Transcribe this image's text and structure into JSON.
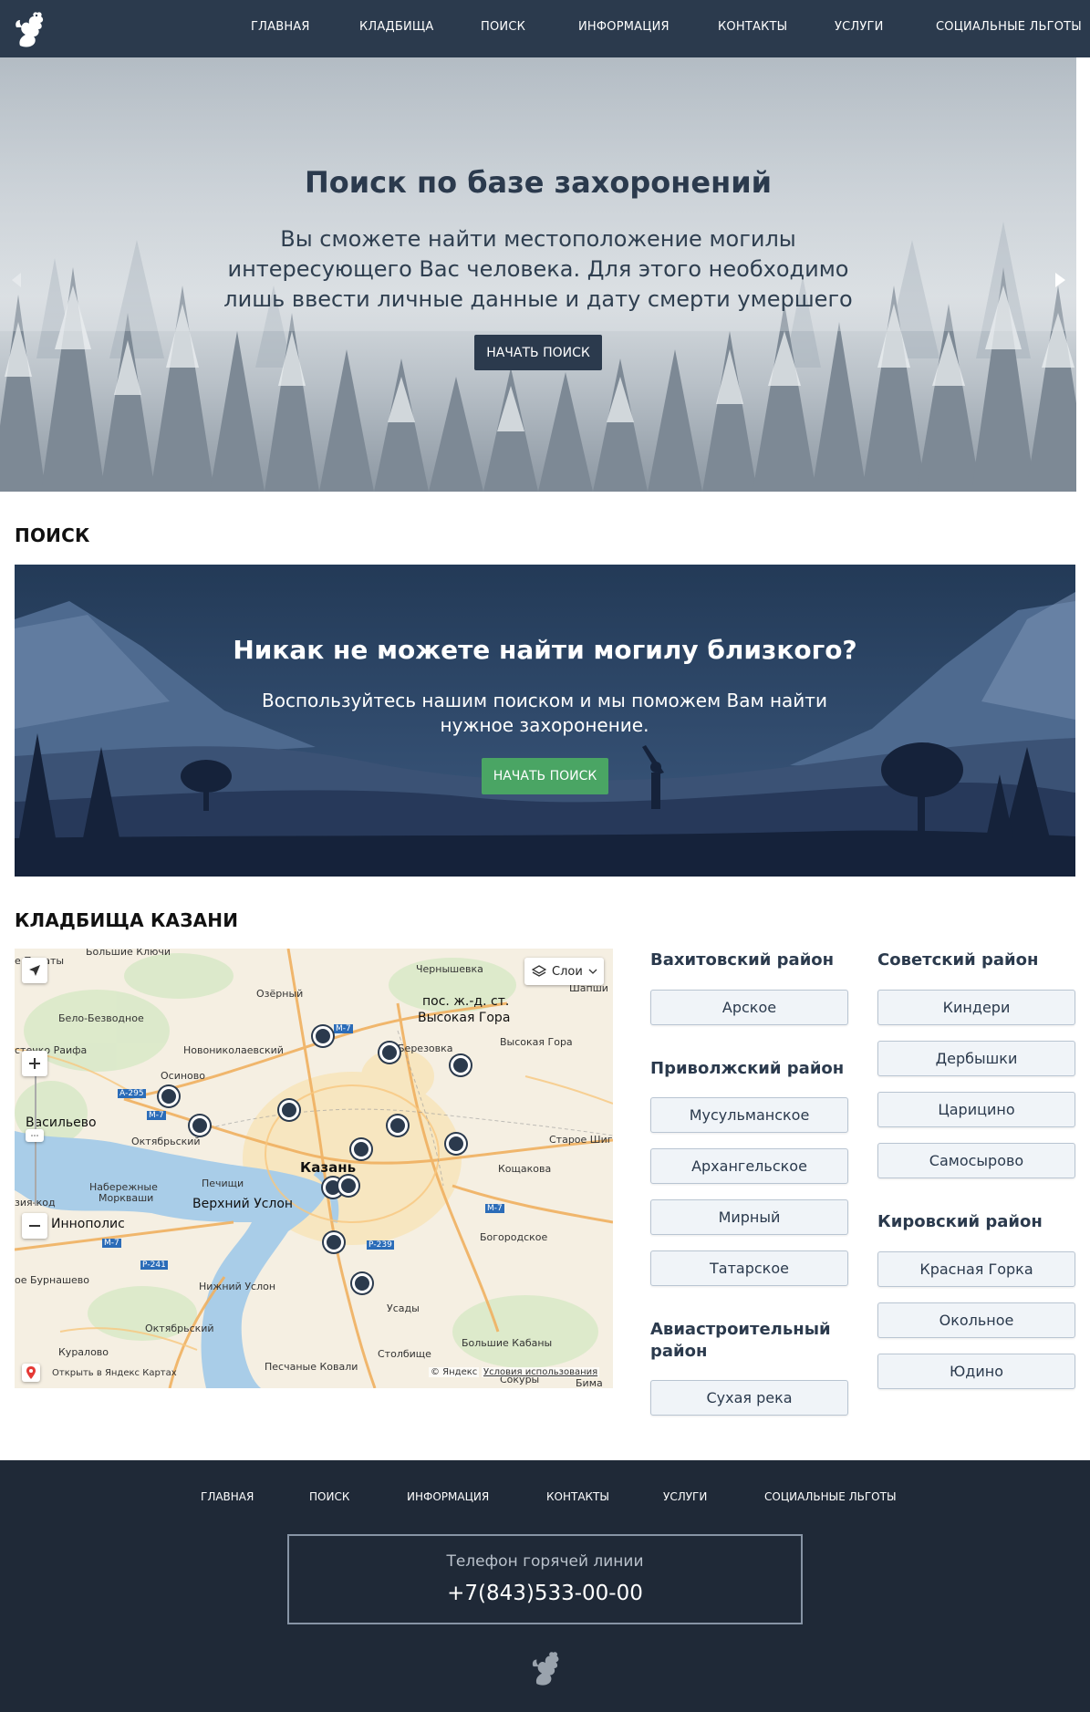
{
  "nav": {
    "items": [
      "ГЛАВНАЯ",
      "КЛАДБИЩА",
      "ПОИСК",
      "ИНФОРМАЦИЯ",
      "КОНТАКТЫ",
      "УСЛУГИ",
      "СОЦИАЛЬНЫЕ ЛЬГОТЫ"
    ]
  },
  "hero": {
    "title": "Поиск по базе захоронений",
    "text": "Вы сможете найти местоположение могилы интересующего Вас человека. Для этого необходимо лишь ввести личные данные и дату смерти умершего",
    "button": "НАЧАТЬ ПОИСК"
  },
  "search_section": {
    "heading": "ПОИСК",
    "banner_title": "Никак не можете найти могилу близкого?",
    "banner_text": "Воспользуйтесь нашим поиском и мы поможем Вам найти нужное захоронение.",
    "button": "НАЧАТЬ ПОИСК"
  },
  "cemeteries_section": {
    "heading": "КЛАДБИЩА КАЗАНИ"
  },
  "map": {
    "layers_label": "Слои",
    "open_in_maps": "Открыть в Яндекс Картах",
    "copyright": "© Яндекс",
    "terms": "Условия использования",
    "labels": {
      "bolshie_klyuchi": "Большие Ключи",
      "paraty": "е Параты",
      "chernyshevka": "Чернышевка",
      "shapshi": "Шапши",
      "ozerny": "Озёрный",
      "pos_vysokaya_gora": "пос. ж.-д. ст.",
      "vysokaya_gora_big": "Высокая Гора",
      "belo_bezvodnoe": "Бело-Безводное",
      "novonikolaevsky": "Новониколаевский",
      "berezovka": "Березовка",
      "vysokaya_gora": "Высокая Гора",
      "raifa": "стечко Раифа",
      "osinovo": "Осиново",
      "vasilevo": "Васильево",
      "oktyabrsky1": "Октябрьский",
      "staroe_shigaleevo": "Старое Шига",
      "kazan": "Казань",
      "koshchakovo": "Кощакова",
      "pechishchi": "Печищи",
      "naberezhnye_morkvashi": "Набережные",
      "morkvashi": "Моркваши",
      "verkhny_uslon": "Верхний Услон",
      "vasilevo2": "зия-код",
      "innopolis": "Иннополис",
      "bogorodskoe": "Богородское",
      "burnashevo": "ое Бурнашево",
      "nizhny_uslon": "Нижний Услон",
      "usady": "Усады",
      "oktyabrsky2": "Октябрьский",
      "kuralovo": "Куралово",
      "stolbishche": "Столбище",
      "bolshie_kabany": "Большие Кабаны",
      "peschanye_kovali": "Песчаные Ковали",
      "sokury": "Сокуры",
      "bima": "Бима",
      "m7a": "М-7",
      "a295": "А-295",
      "m7b": "М-7",
      "m7c": "М-7",
      "p241": "Р-241",
      "m7d": "М-7",
      "p239": "Р-239"
    }
  },
  "districts": [
    {
      "name": "Вахитовский район",
      "cemeteries": [
        "Арское"
      ]
    },
    {
      "name": "Приволжский район",
      "cemeteries": [
        "Мусульманское",
        "Архангельское",
        "Мирный",
        "Татарское"
      ]
    },
    {
      "name": "Авиастроительный район",
      "cemeteries": [
        "Сухая река"
      ]
    },
    {
      "name": "Советский район",
      "cemeteries": [
        "Киндери",
        "Дербышки",
        "Царицино",
        "Самосырово"
      ]
    },
    {
      "name": "Кировский район",
      "cemeteries": [
        "Красная Горка",
        "Окольное",
        "Юдино"
      ]
    }
  ],
  "footer": {
    "nav": [
      "ГЛАВНАЯ",
      "ПОИСК",
      "ИНФОРМАЦИЯ",
      "КОНТАКТЫ",
      "УСЛУГИ",
      "СОЦИАЛЬНЫЕ ЛЬГОТЫ"
    ],
    "hotline_label": "Телефон горячей линии",
    "hotline_phone": "+7(843)533-00-00"
  },
  "colors": {
    "nav_bg": "#2b3a4d",
    "footer_bg": "#1f2937",
    "accent_green": "#4aa564",
    "banner_bg": "#27405f"
  }
}
